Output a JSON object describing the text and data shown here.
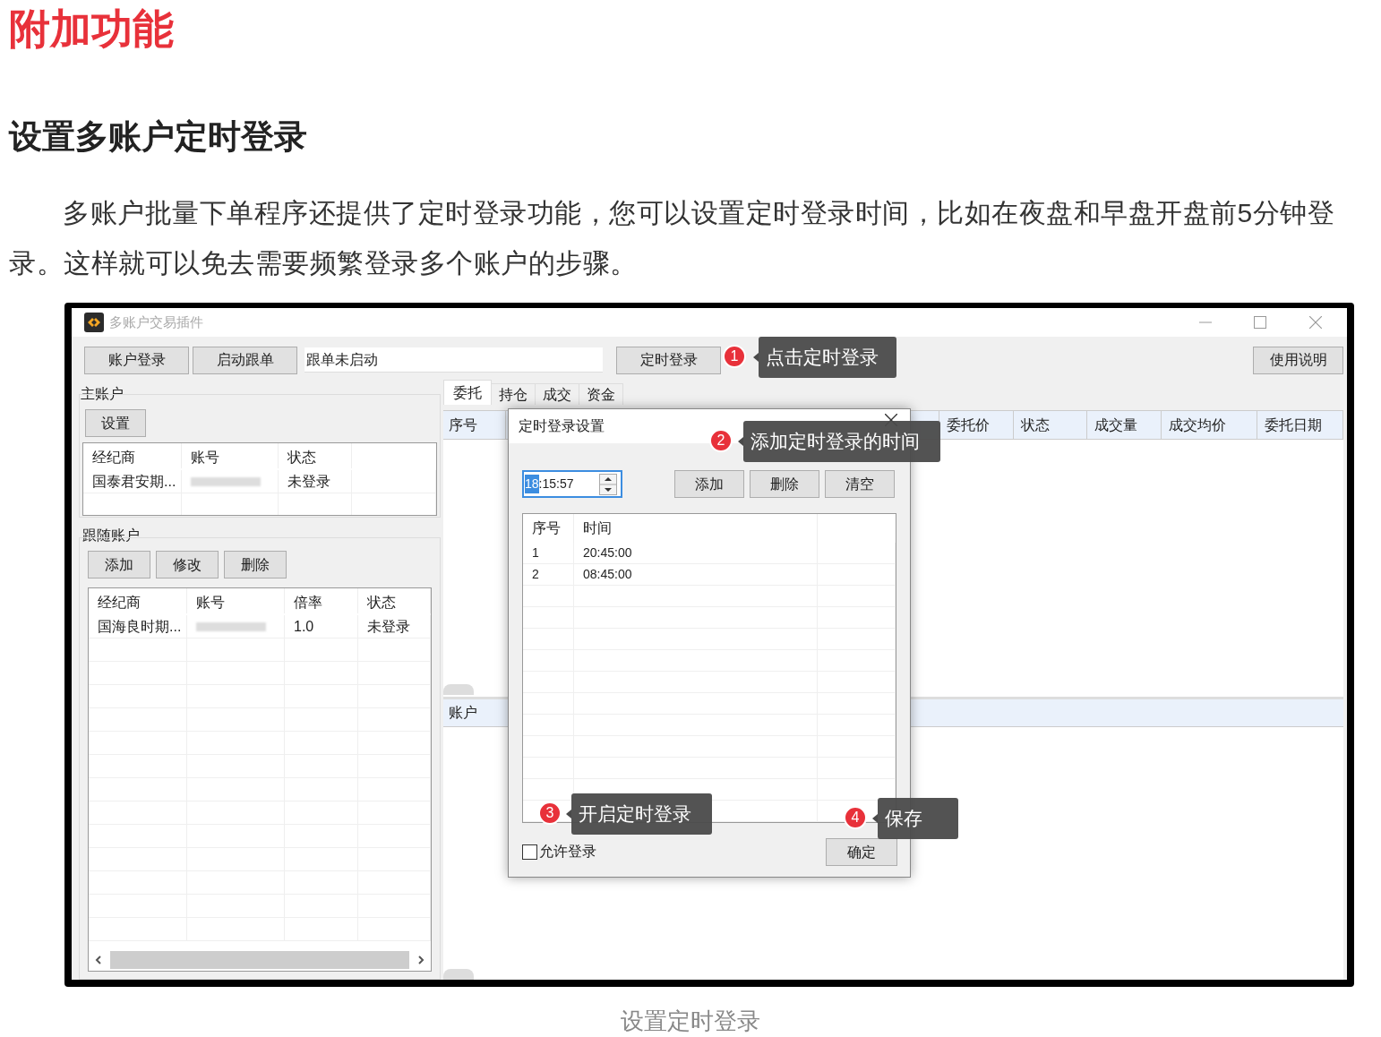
{
  "article": {
    "heading": "附加功能",
    "subheading": "设置多账户定时登录",
    "paragraph": "多账户批量下单程序还提供了定时登录功能，您可以设置定时登录时间，比如在夜盘和早盘开盘前5分钟登录。这样就可以免去需要频繁登录多个账户的步骤。",
    "caption": "设置定时登录"
  },
  "window": {
    "title": "多账户交易插件"
  },
  "toolbar": {
    "buttons": [
      "账户登录",
      "启动跟单"
    ],
    "status_field": "跟单未启动",
    "timer_button": "定时登录",
    "help_button": "使用说明"
  },
  "main_account": {
    "label": "主账户",
    "button": "设置",
    "columns": [
      "经纪商",
      "账号",
      "状态"
    ],
    "rows": [
      {
        "broker": "国泰君安期...",
        "status": "未登录"
      }
    ]
  },
  "follow_accounts": {
    "label": "跟随账户",
    "buttons": [
      "添加",
      "修改",
      "删除"
    ],
    "columns": [
      "经纪商",
      "账号",
      "倍率",
      "状态"
    ],
    "rows": [
      {
        "broker": "国海良时期...",
        "ratio": "1.0",
        "status": "未登录"
      }
    ]
  },
  "tabs": [
    {
      "label": "委托",
      "selected": true
    },
    {
      "label": "持仓",
      "selected": false
    },
    {
      "label": "成交",
      "selected": false
    },
    {
      "label": "资金",
      "selected": false
    }
  ],
  "orders_table": {
    "first_column": "序号",
    "columns": [
      "委托价",
      "状态",
      "成交量",
      "成交均价",
      "委托日期"
    ]
  },
  "accounts_table": {
    "columns": [
      "账户"
    ]
  },
  "dialog": {
    "title": "定时登录设置",
    "time": {
      "selected_part": "18",
      "rest": ":15:57"
    },
    "buttons": [
      "添加",
      "删除",
      "清空"
    ],
    "columns": [
      "序号",
      "时间"
    ],
    "rows": [
      [
        "1",
        "20:45:00"
      ],
      [
        "2",
        "08:45:00"
      ]
    ],
    "allow_login": {
      "label": "允许登录",
      "checked": false
    },
    "ok_button": "确定"
  },
  "callouts": [
    {
      "number": "1",
      "text": "点击定时登录"
    },
    {
      "number": "2",
      "text": "添加定时登录的时间"
    },
    {
      "number": "3",
      "text": "开启定时登录"
    },
    {
      "number": "4",
      "text": "保存"
    }
  ]
}
